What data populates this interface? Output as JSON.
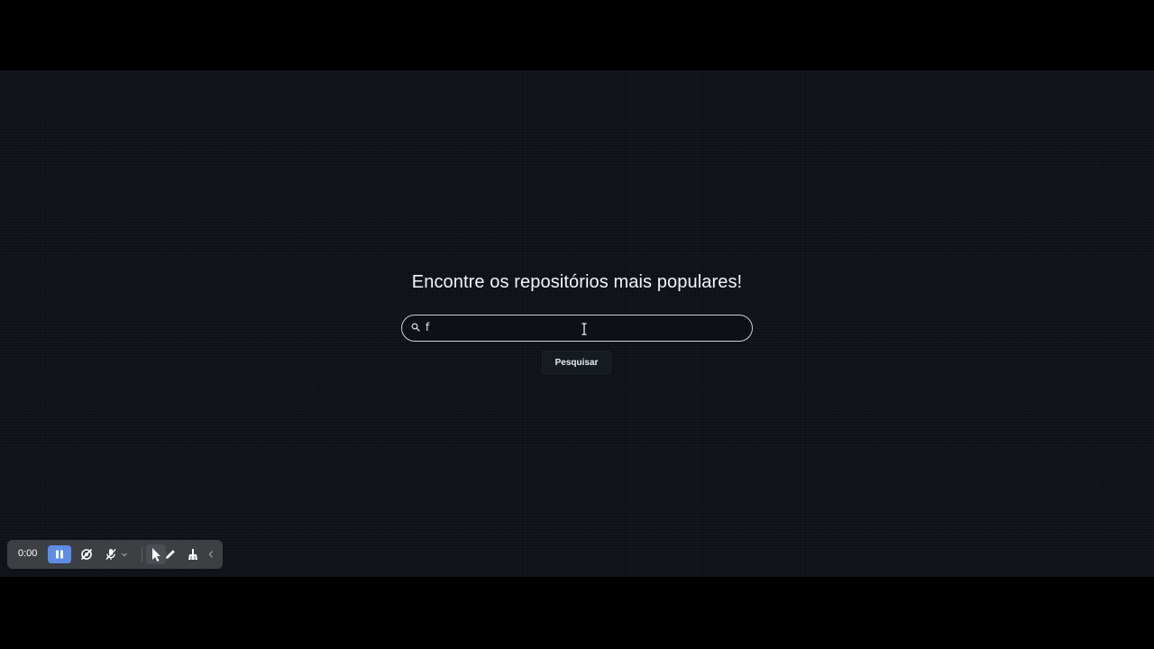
{
  "page": {
    "heading": "Encontre os repositórios mais populares!",
    "search": {
      "value": "f",
      "icon": "search-icon"
    },
    "search_button_label": "Pesquisar"
  },
  "recorder_toolbar": {
    "time": "0:00",
    "icons": [
      "pause-icon",
      "camera-off-icon",
      "mic-off-icon",
      "chevron-down-icon",
      "pointer-icon",
      "pen-icon",
      "broom-icon",
      "chevron-left-icon"
    ]
  },
  "colors": {
    "background": "#0d1117",
    "text": "#f0f6fc",
    "accent": "#5e8de6",
    "toolbar": "#3c4043"
  }
}
